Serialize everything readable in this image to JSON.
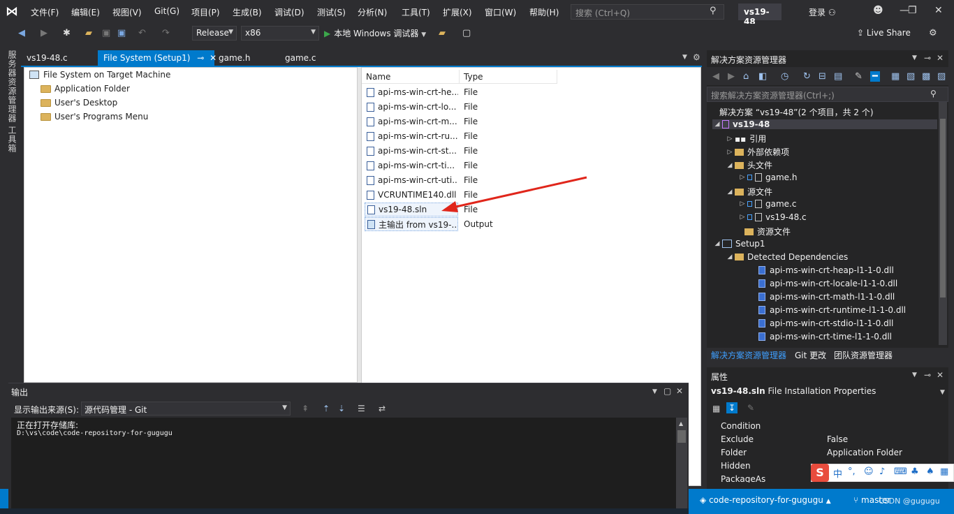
{
  "menu": {
    "items": [
      "文件(F)",
      "编辑(E)",
      "视图(V)",
      "Git(G)",
      "项目(P)",
      "生成(B)",
      "调试(D)",
      "测试(S)",
      "分析(N)",
      "工具(T)",
      "扩展(X)",
      "窗口(W)",
      "帮助(H)"
    ],
    "search_placeholder": "搜索 (Ctrl+Q)",
    "window_title": "vs19-48",
    "login": "登录"
  },
  "toolbar": {
    "config": "Release",
    "platform": "x86",
    "run_label": "本地 Windows 调试器",
    "live_share": "Live Share"
  },
  "left_rail": {
    "server_explorer": "服务器资源管理器",
    "toolbox": "工具箱"
  },
  "doc_tabs": [
    "vs19-48.c",
    "File System (Setup1)",
    "game.h",
    "game.c"
  ],
  "fs_tree": {
    "root": "File System on Target Machine",
    "folders": [
      "Application Folder",
      "User's Desktop",
      "User's Programs Menu"
    ]
  },
  "fs_list": {
    "col_name": "Name",
    "col_type": "Type",
    "rows": [
      {
        "name": "api-ms-win-crt-he...",
        "type": "File"
      },
      {
        "name": "api-ms-win-crt-lo...",
        "type": "File"
      },
      {
        "name": "api-ms-win-crt-m...",
        "type": "File"
      },
      {
        "name": "api-ms-win-crt-ru...",
        "type": "File"
      },
      {
        "name": "api-ms-win-crt-st...",
        "type": "File"
      },
      {
        "name": "api-ms-win-crt-ti...",
        "type": "File"
      },
      {
        "name": "api-ms-win-crt-uti...",
        "type": "File"
      },
      {
        "name": "VCRUNTIME140.dll",
        "type": "File"
      },
      {
        "name": "vs19-48.sln",
        "type": "File"
      },
      {
        "name": "主输出 from vs19-...",
        "type": "Output"
      }
    ]
  },
  "solution_explorer": {
    "title": "解决方案资源管理器",
    "search_placeholder": "搜索解决方案资源管理器(Ctrl+;)",
    "solution": "解决方案 “vs19-48”(2 个项目，共 2 个)",
    "project": "vs19-48",
    "references": "引用",
    "external_deps": "外部依赖项",
    "header_files": "头文件",
    "game_h": "game.h",
    "source_files": "源文件",
    "game_c": "game.c",
    "vs19_48_c": "vs19-48.c",
    "resource_files": "资源文件",
    "setup": "Setup1",
    "detected_deps": "Detected Dependencies",
    "dlls": [
      "api-ms-win-crt-heap-l1-1-0.dll",
      "api-ms-win-crt-locale-l1-1-0.dll",
      "api-ms-win-crt-math-l1-1-0.dll",
      "api-ms-win-crt-runtime-l1-1-0.dll",
      "api-ms-win-crt-stdio-l1-1-0.dll",
      "api-ms-win-crt-time-l1-1-0.dll"
    ],
    "tabs": [
      "解决方案资源管理器",
      "Git 更改",
      "团队资源管理器"
    ]
  },
  "properties": {
    "title": "属性",
    "object_name": "vs19-48.sln",
    "object_type": "File Installation Properties",
    "rows": [
      {
        "key": "Condition",
        "value": ""
      },
      {
        "key": "Exclude",
        "value": "False"
      },
      {
        "key": "Folder",
        "value": "Application Folder"
      },
      {
        "key": "Hidden",
        "value": ""
      },
      {
        "key": "PackageAs",
        "value": ""
      }
    ]
  },
  "output": {
    "title": "输出",
    "source_label": "显示输出来源(S):",
    "source_value": "源代码管理 - Git",
    "lines": [
      "正在打开存储库:",
      "D:\\vs\\code\\code-repository-for-gugugu"
    ]
  },
  "status": {
    "repo": "code-repository-for-gugugu",
    "branch": "master",
    "watermark": "CSDN @gugugu"
  },
  "ime": {
    "logo": "S",
    "lang": "中"
  },
  "colors": {
    "accent": "#007acc",
    "arrow": "#e0261b"
  }
}
